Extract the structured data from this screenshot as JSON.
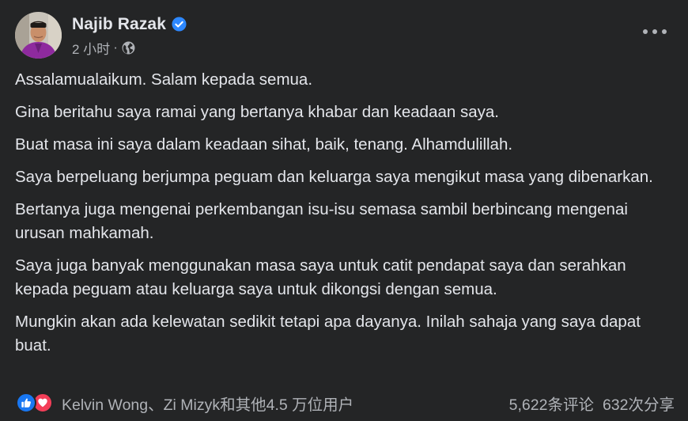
{
  "post": {
    "author": "Najib Razak",
    "time": "2 小时",
    "meta_separator": "·",
    "icons": {
      "verified": "verified-badge-icon",
      "audience": "globe-icon",
      "more": "more-options-icon",
      "reaction_like": "like-icon",
      "reaction_love": "love-icon"
    },
    "paragraphs": [
      "Assalamualaikum. Salam kepada semua.",
      "Gina beritahu saya ramai yang bertanya khabar dan keadaan saya.",
      "Buat masa ini saya dalam keadaan sihat, baik, tenang. Alhamdulillah.",
      "Saya berpeluang berjumpa peguam dan keluarga saya mengikut masa yang dibenarkan.",
      "Bertanya juga mengenai perkembangan isu-isu semasa sambil berbincang mengenai urusan mahkamah.",
      "Saya juga banyak menggunakan masa saya untuk catit pendapat saya dan serahkan kepada peguam atau keluarga saya untuk dikongsi dengan semua.",
      "Mungkin akan ada kelewatan sedikit tetapi apa dayanya. Inilah sahaja yang saya dapat buat."
    ],
    "reactions_text": "Kelvin Wong、Zi Mizyk和其他4.5 万位用户",
    "comments_text": "5,622条评论",
    "shares_text": "632次分享"
  },
  "colors": {
    "background": "#242526",
    "primary_text": "#e4e6eb",
    "secondary_text": "#b0b3b8",
    "like_blue": "#1877f2",
    "love_red": "#f33e58"
  }
}
